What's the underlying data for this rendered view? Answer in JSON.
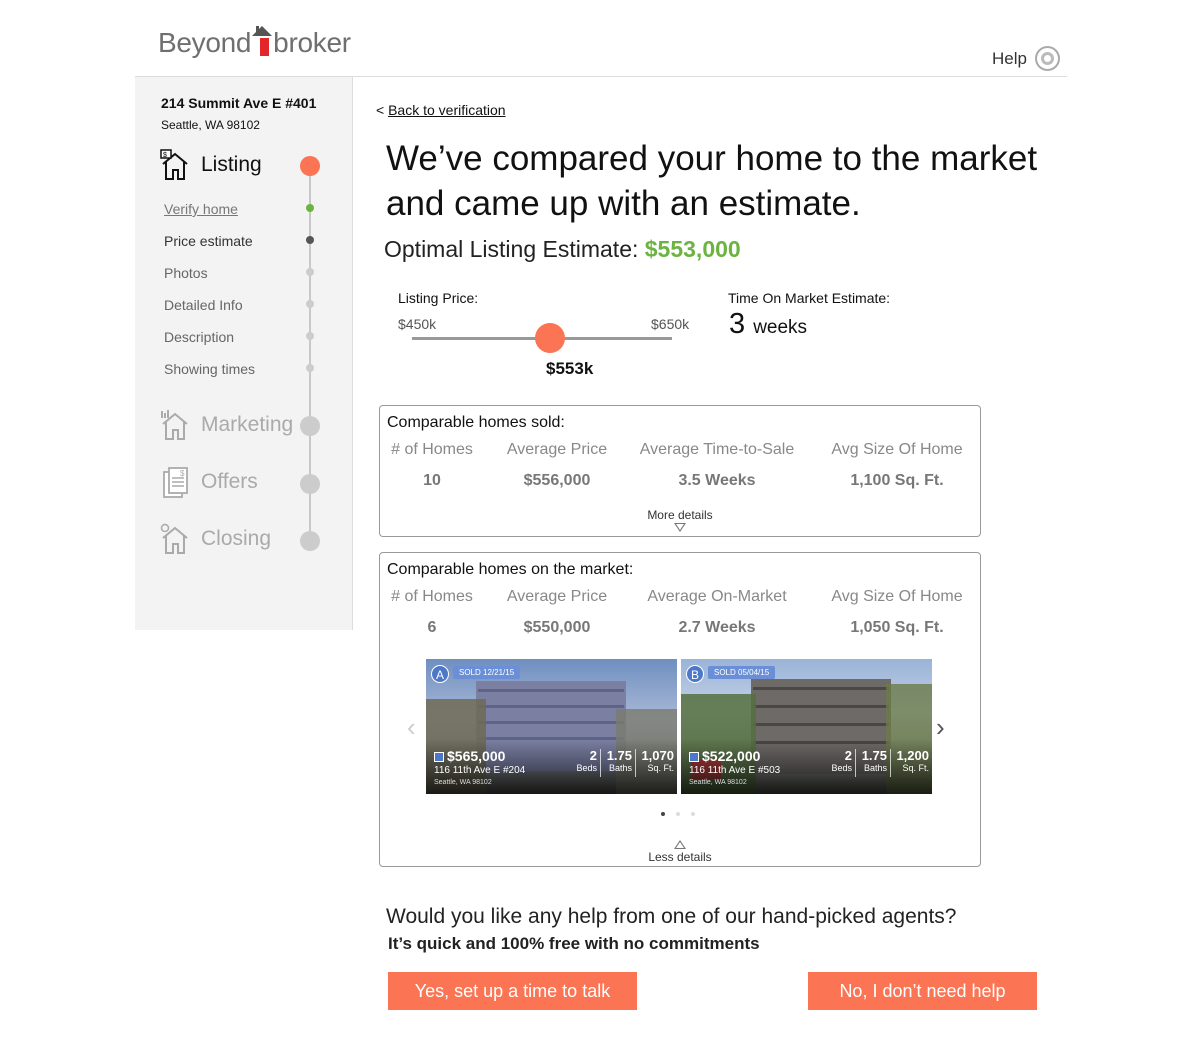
{
  "header": {
    "logo_left": "Beyond",
    "logo_right": "broker",
    "help_label": "Help"
  },
  "sidebar": {
    "address_line1": "214 Summit Ave E #401",
    "address_line2": "Seattle, WA 98102",
    "steps": [
      {
        "label": "Listing",
        "state": "active",
        "color": "#fb7454"
      },
      {
        "label": "Marketing",
        "state": "inactive"
      },
      {
        "label": "Offers",
        "state": "inactive"
      },
      {
        "label": "Closing",
        "state": "inactive"
      }
    ],
    "substeps": [
      {
        "label": "Verify home",
        "state": "done",
        "dot_color": "#6cb33f"
      },
      {
        "label": "Price estimate",
        "state": "current",
        "dot_color": "#555555"
      },
      {
        "label": "Photos",
        "state": "pending"
      },
      {
        "label": "Detailed Info",
        "state": "pending"
      },
      {
        "label": "Description",
        "state": "pending"
      },
      {
        "label": "Showing times",
        "state": "pending"
      }
    ]
  },
  "main": {
    "back_prefix": "<",
    "back_link": "Back to verification",
    "headline": "We’ve compared your home to the market and came up with an estimate.",
    "estimate_label": "Optimal Listing Estimate:",
    "estimate_value": "$553,000",
    "listing_price": {
      "label": "Listing Price:",
      "min": "$450k",
      "max": "$650k",
      "value": "$553k",
      "fraction": 0.53
    },
    "time_on_market": {
      "label": "Time On Market Estimate:",
      "value": "3",
      "unit": "weeks"
    },
    "sold": {
      "title": "Comparable homes sold:",
      "headers": [
        "# of Homes",
        "Average Price",
        "Average Time-to-Sale",
        "Avg Size Of Home"
      ],
      "values": [
        "10",
        "$556,000",
        "3.5 Weeks",
        "1,100 Sq. Ft."
      ],
      "toggle": "More details"
    },
    "market": {
      "title": "Comparable homes on the market:",
      "headers": [
        "# of Homes",
        "Average Price",
        "Average On-Market",
        "Avg Size Of Home"
      ],
      "values": [
        "6",
        "$550,000",
        "2.7 Weeks",
        "1,050 Sq. Ft."
      ],
      "toggle": "Less details",
      "cards": [
        {
          "pin": "A",
          "sold": "SOLD 12/21/15",
          "price": "$565,000",
          "street": "116 11th Ave E #204",
          "city": "Seattle, WA 98102",
          "beds": "2",
          "beds_label": "Beds",
          "baths": "1.75",
          "baths_label": "Baths",
          "sqft": "1,070",
          "sqft_label": "Sq. Ft."
        },
        {
          "pin": "B",
          "sold": "SOLD 05/04/15",
          "price": "$522,000",
          "street": "116 11th Ave E #503",
          "city": "Seattle, WA 98102",
          "beds": "2",
          "beds_label": "Beds",
          "baths": "1.75",
          "baths_label": "Baths",
          "sqft": "1,200",
          "sqft_label": "Sq. Ft."
        }
      ],
      "pager_total": 3,
      "pager_current": 1
    },
    "help_question": "Would you like any help from one of our hand-picked agents?",
    "help_sub": "It’s quick and 100% free with no commitments",
    "btn_yes": "Yes, set up a time to talk",
    "btn_no": "No, I don’t need help"
  },
  "colors": {
    "accent": "#fb7454",
    "price_green": "#6cb33f",
    "pin_blue": "#4c78c9"
  }
}
